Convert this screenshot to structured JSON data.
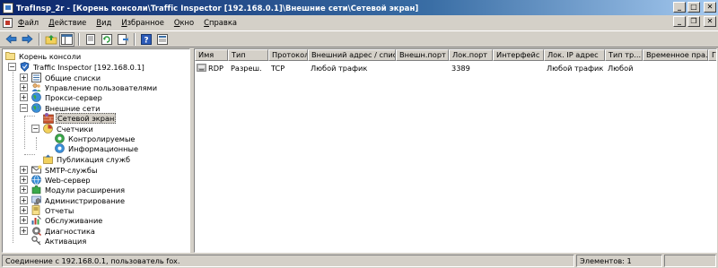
{
  "window": {
    "title": "TrafInsp_2r - [Корень консоли\\Traffic Inspector [192.168.0.1]\\Внешние сети\\Сетевой экран]",
    "buttons": {
      "minimize": "_",
      "maximize": "□",
      "close": "✕"
    }
  },
  "menu": {
    "items": [
      {
        "label": "Файл",
        "u": "Ф",
        "rest": "айл"
      },
      {
        "label": "Действие",
        "u": "Д",
        "rest": "ействие"
      },
      {
        "label": "Вид",
        "u": "В",
        "rest": "ид"
      },
      {
        "label": "Избранное",
        "u": "И",
        "rest": "збранное"
      },
      {
        "label": "Окно",
        "u": "О",
        "rest": "кно"
      },
      {
        "label": "Справка",
        "u": "С",
        "rest": "правка"
      }
    ],
    "child_buttons": {
      "minimize": "_",
      "restore": "❐",
      "close": "✕"
    }
  },
  "toolbar": {
    "buttons": [
      "back-icon",
      "forward-icon",
      "up-folder-icon",
      "show-hide-tree-icon",
      "properties-icon",
      "refresh-icon",
      "export-list-icon",
      "help-icon",
      "help-topics-icon"
    ]
  },
  "tree": {
    "root": "Корень консоли",
    "server": "Traffic Inspector [192.168.0.1]",
    "items": [
      "Общие списки",
      "Управление пользователями",
      "Прокси-сервер",
      "Внешние сети",
      "Сетевой экран",
      "Счетчики",
      "Контролируемые",
      "Информационные",
      "Публикация служб",
      "SMTP-службы",
      "Web-сервер",
      "Модули расширения",
      "Администрирование",
      "Отчеты",
      "Обслуживание",
      "Диагностика",
      "Активация"
    ],
    "expanders": {
      "plus": "+",
      "minus": "−"
    }
  },
  "list": {
    "columns": [
      "Имя",
      "Тип",
      "Протокол",
      "Внешний адрес / список",
      "Внешн.порт",
      "Лок.порт",
      "Интерфейс",
      "Лок. IP адрес",
      "Тип тр...",
      "Временное пра...",
      "Г"
    ],
    "rows": [
      [
        "RDP",
        "Разреш.",
        "TCP",
        "Любой трафик",
        "",
        "3389",
        "",
        "Любой трафик",
        "Любой",
        "",
        ""
      ]
    ]
  },
  "status": {
    "connection": "Соединение с 192.168.0.1, пользователь fox.",
    "elements": "Элементов: 1"
  },
  "colors": {
    "title_start": "#0a246a",
    "title_end": "#a6caf0",
    "face": "#d4d0c8",
    "selection": "#d4d0c8"
  }
}
